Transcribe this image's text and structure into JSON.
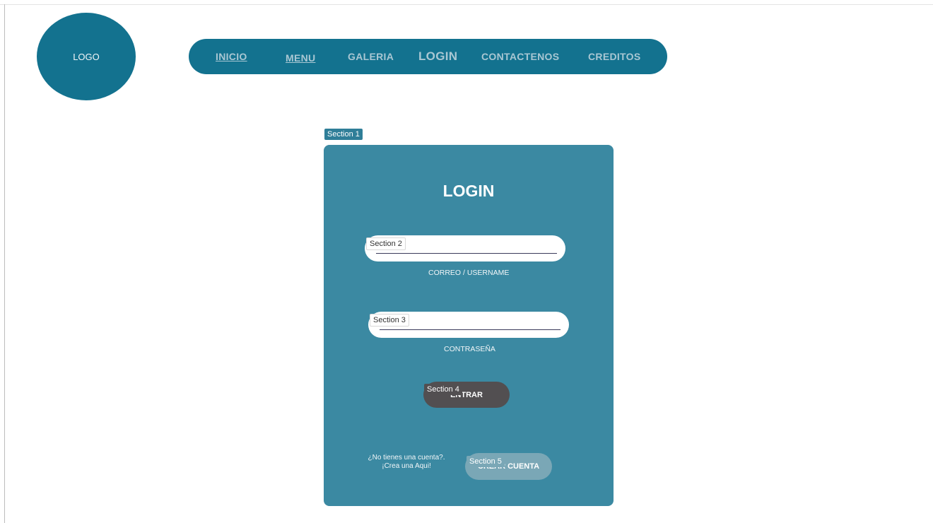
{
  "logo": {
    "text": "LOGO"
  },
  "nav": {
    "items": [
      {
        "label": "INICIO"
      },
      {
        "label": "MENU"
      },
      {
        "label": "GALERIA"
      },
      {
        "label": "LOGIN"
      },
      {
        "label": "CONTACTENOS"
      },
      {
        "label": "CREDITOS"
      }
    ]
  },
  "sections": {
    "s1": "Section 1",
    "s2": "Section 2",
    "s3": "Section 3",
    "s4": "Section 4",
    "s5": "Section 5"
  },
  "login": {
    "title": "LOGIN",
    "username_label": "CORREO / USERNAME",
    "password_label": "CONTRASEÑA",
    "submit_label": "ENTRAR",
    "signup_prompt_line1": "¿No tienes una cuenta?.",
    "signup_prompt_line2": "¡Crea una Aqui!",
    "create_label": "CREAR CUENTA"
  },
  "colors": {
    "primary": "#13728f",
    "card": "#3b89a2",
    "submit": "#524f51",
    "create": "#7aa7b6"
  }
}
